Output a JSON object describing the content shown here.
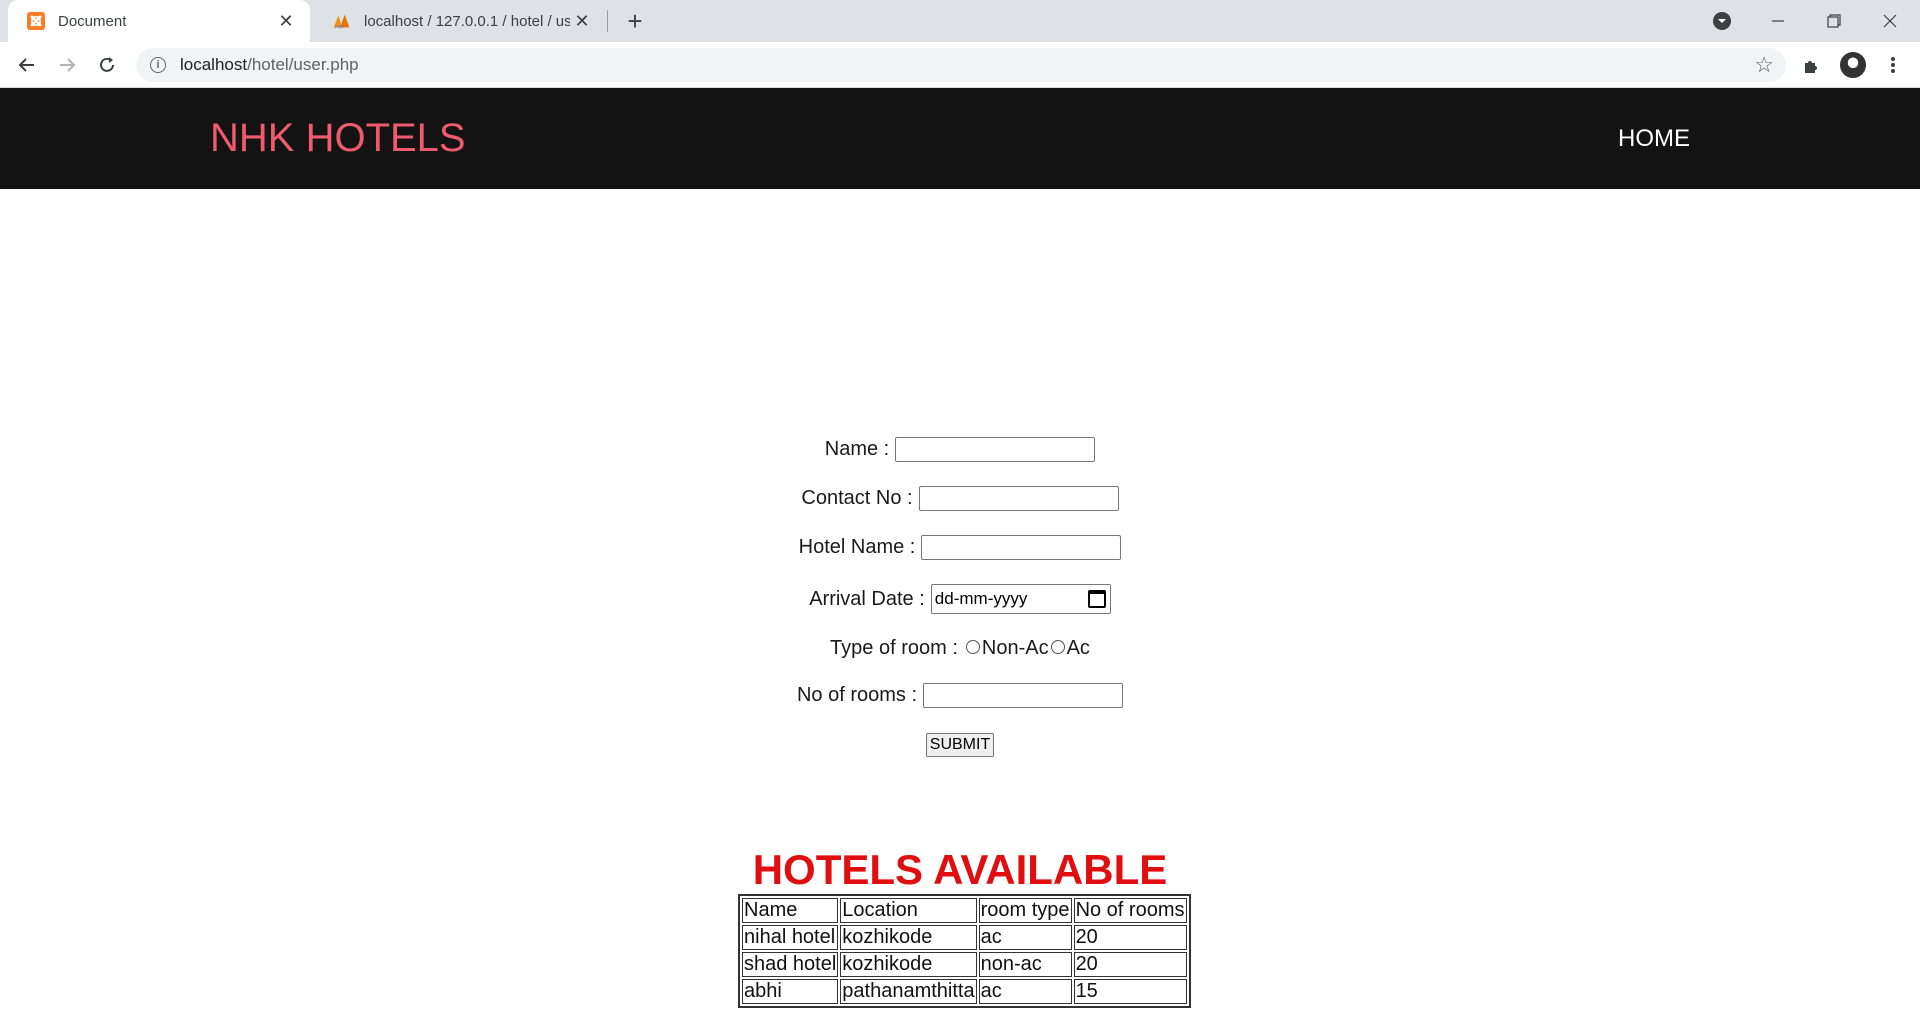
{
  "browser": {
    "tabs": [
      {
        "title": "Document",
        "icon": "xampp-icon"
      },
      {
        "title": "localhost / 127.0.0.1 / hotel / use",
        "icon": "phpmyadmin-icon"
      }
    ],
    "url_host": "localhost",
    "url_path": "/hotel/user.php"
  },
  "navbar": {
    "brand": "NHK HOTELS",
    "home": "HOME",
    "brand_color": "#f05a6e",
    "background": "#131313"
  },
  "form": {
    "name_label": "Name :",
    "contact_label": "Contact No :",
    "hotel_label": "Hotel Name :",
    "date_label": "Arrival Date :",
    "date_placeholder": "dd-mm-yyyy",
    "room_type_label": "Type of room :",
    "room_option_1": "Non-Ac",
    "room_option_2": "Ac",
    "rooms_label": "No of rooms :",
    "submit": "SUBMIT"
  },
  "hotels": {
    "title": "HOTELS AVAILABLE",
    "title_color": "#e00e0e",
    "headers": [
      "Name",
      "Location",
      "room type",
      "No of rooms"
    ],
    "rows": [
      [
        "nihal hotel",
        "kozhikode",
        "ac",
        "20"
      ],
      [
        "shad hotel",
        "kozhikode",
        "non-ac",
        "20"
      ],
      [
        "abhi",
        "pathanamthitta",
        "ac",
        "15"
      ]
    ]
  }
}
